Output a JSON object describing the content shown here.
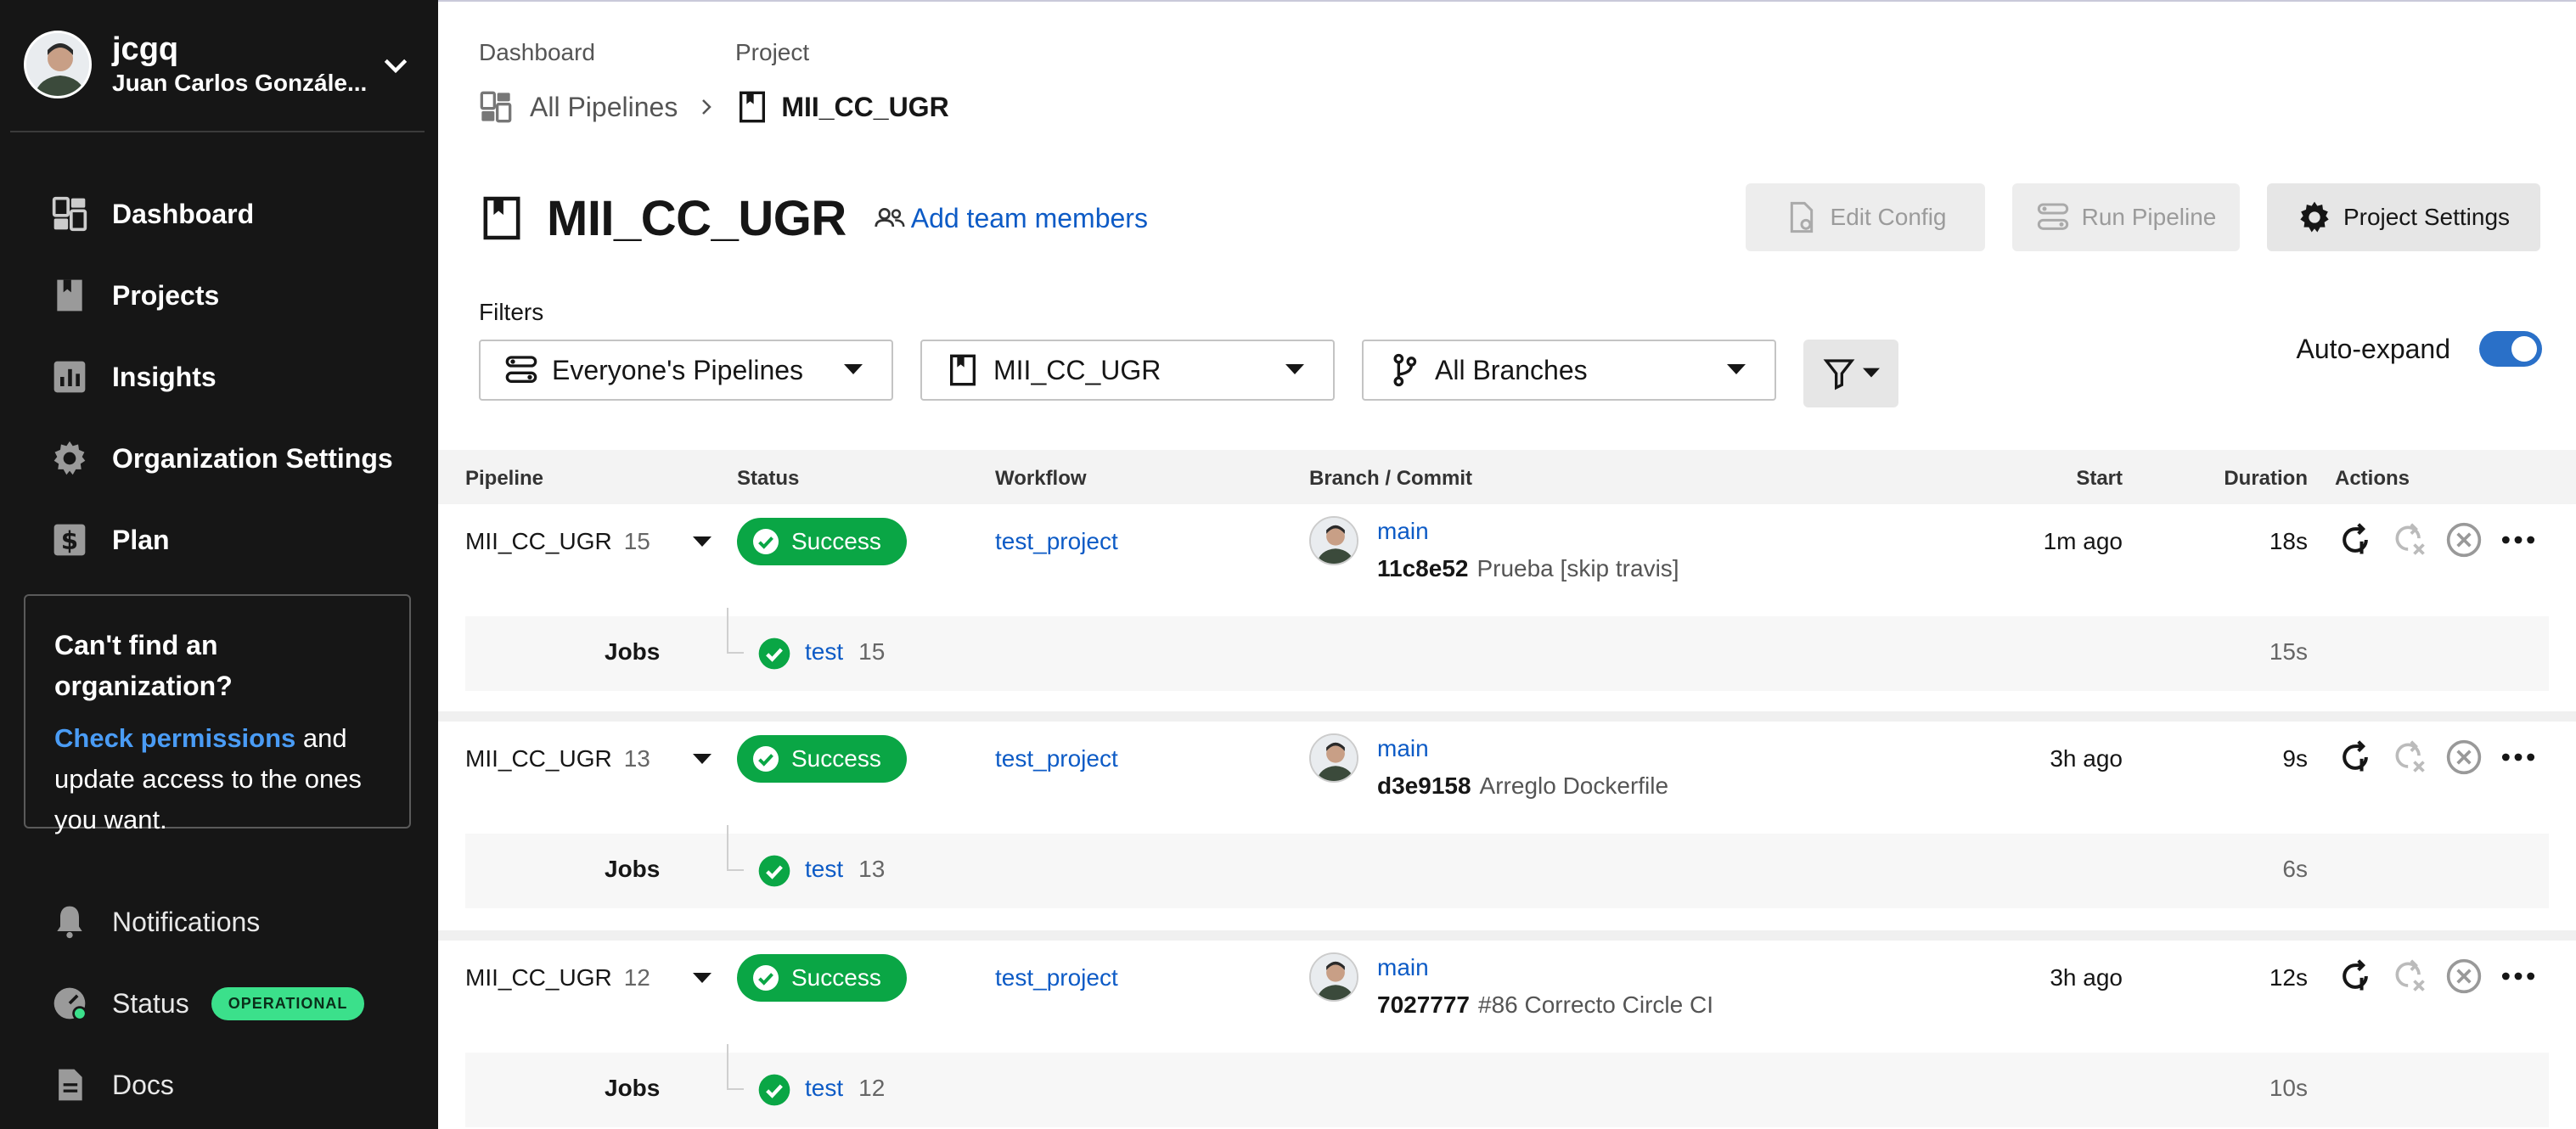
{
  "user": {
    "login": "jcgq",
    "name": "Juan Carlos Gonzále..."
  },
  "nav": {
    "items": [
      {
        "label": "Dashboard",
        "icon": "dashboard-icon"
      },
      {
        "label": "Projects",
        "icon": "book-icon"
      },
      {
        "label": "Insights",
        "icon": "insights-icon"
      },
      {
        "label": "Organization Settings",
        "icon": "gear-icon"
      },
      {
        "label": "Plan",
        "icon": "dollar-icon"
      }
    ],
    "bottom": [
      {
        "label": "Notifications",
        "icon": "bell-icon"
      },
      {
        "label": "Status",
        "icon": "status-gauge-icon",
        "badge": "OPERATIONAL"
      },
      {
        "label": "Docs",
        "icon": "doc-icon"
      }
    ]
  },
  "orgbox": {
    "title": "Can't find an organization?",
    "link": "Check permissions",
    "text": " and update access to the ones you want."
  },
  "breadcrumb": {
    "label1": "Dashboard",
    "label2": "Project",
    "link": "All Pipelines",
    "current": "MII_CC_UGR"
  },
  "header": {
    "title": "MII_CC_UGR",
    "add_team": "Add team members",
    "edit_config": "Edit Config",
    "run_pipeline": "Run Pipeline",
    "project_settings": "Project Settings"
  },
  "filters": {
    "label": "Filters",
    "pipelines": "Everyone's Pipelines",
    "project": "MII_CC_UGR",
    "branches": "All Branches",
    "auto_expand": "Auto-expand",
    "auto_expand_on": true
  },
  "table": {
    "headers": {
      "pipeline": "Pipeline",
      "status": "Status",
      "workflow": "Workflow",
      "branch_commit": "Branch / Commit",
      "start": "Start",
      "duration": "Duration",
      "actions": "Actions"
    },
    "rows": [
      {
        "pipeline": "MII_CC_UGR",
        "number": "15",
        "status": "Success",
        "workflow": "test_project",
        "branch": "main",
        "sha": "11c8e52",
        "message": "Prueba [skip travis]",
        "start": "1m ago",
        "duration": "18s",
        "jobs_label": "Jobs",
        "job": "test",
        "job_number": "15",
        "job_duration": "15s"
      },
      {
        "pipeline": "MII_CC_UGR",
        "number": "13",
        "status": "Success",
        "workflow": "test_project",
        "branch": "main",
        "sha": "d3e9158",
        "message": "Arreglo Dockerfile",
        "start": "3h ago",
        "duration": "9s",
        "jobs_label": "Jobs",
        "job": "test",
        "job_number": "13",
        "job_duration": "6s"
      },
      {
        "pipeline": "MII_CC_UGR",
        "number": "12",
        "status": "Success",
        "workflow": "test_project",
        "branch": "main",
        "sha": "7027777",
        "message": "#86 Correcto Circle CI",
        "start": "3h ago",
        "duration": "12s",
        "jobs_label": "Jobs",
        "job": "test",
        "job_number": "12",
        "job_duration": "10s"
      }
    ]
  },
  "colors": {
    "sidebar_bg": "#161616",
    "success": "#0aa645",
    "link": "#0d5bc6",
    "toggle_on": "#2a70c8",
    "status_badge": "#3be08b"
  }
}
